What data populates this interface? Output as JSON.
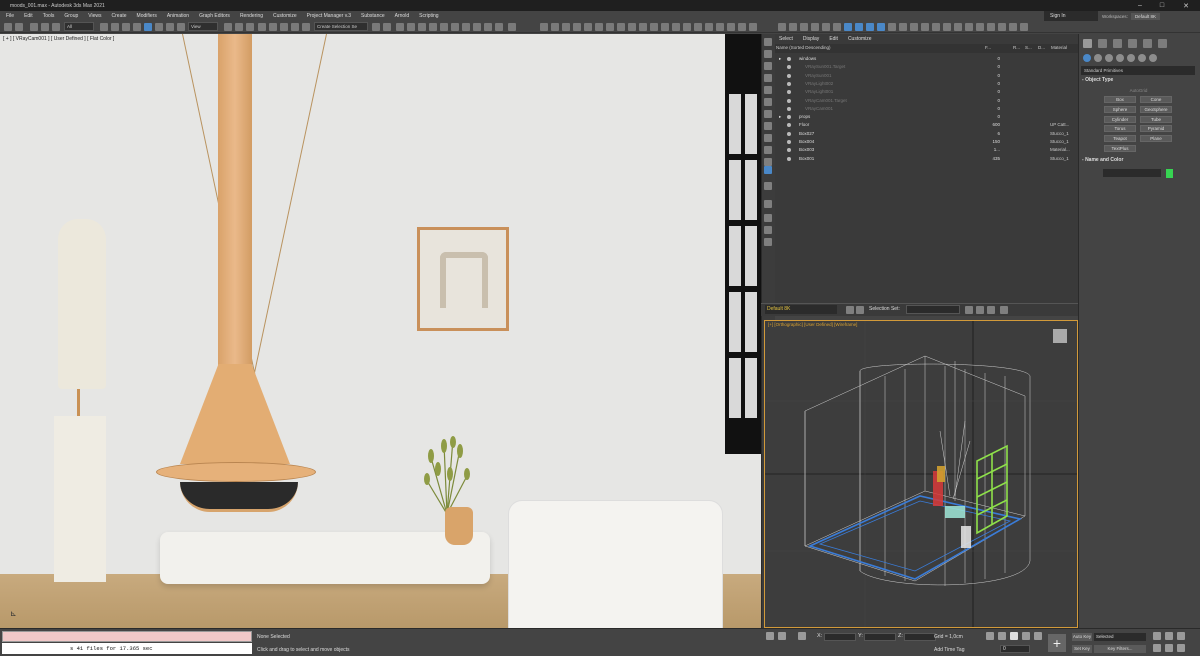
{
  "window": {
    "title": "moods_001.max - Autodesk 3ds Max 2021"
  },
  "menu": [
    "File",
    "Edit",
    "Tools",
    "Group",
    "Views",
    "Create",
    "Modifiers",
    "Animation",
    "Graph Editors",
    "Rendering",
    "Customize",
    "Project Manager v.3",
    "Substance",
    "Arnold",
    "Scripting"
  ],
  "account": {
    "signin": "Sign In",
    "workspace_label": "Workspaces:",
    "workspace_value": "Default 8K"
  },
  "toolbar": {
    "filter": "All",
    "view": "View",
    "selection_set": "Create Selection Se"
  },
  "viewport1": {
    "label": "[ + ] [ VRayCam001 ] [ User Defined ] [ Flat Color ]"
  },
  "scene_explorer": {
    "menu": [
      "Select",
      "Display",
      "Edit",
      "Customize"
    ],
    "columns": {
      "name": "Name (Sorted Descending)",
      "faces": "F...",
      "r": "R...",
      "s": "S...",
      "d": "D...",
      "material": "Material"
    },
    "rows": [
      {
        "name": "windows",
        "count": "0",
        "material": "",
        "level": 0,
        "dim": false
      },
      {
        "name": "VRaySun001.Target",
        "count": "0",
        "material": "",
        "level": 1,
        "dim": true
      },
      {
        "name": "VRaySun001",
        "count": "0",
        "material": "",
        "level": 1,
        "dim": true
      },
      {
        "name": "VRayLight002",
        "count": "0",
        "material": "",
        "level": 1,
        "dim": true
      },
      {
        "name": "VRayLight001",
        "count": "0",
        "material": "",
        "level": 1,
        "dim": true
      },
      {
        "name": "VRayCam001.Target",
        "count": "0",
        "material": "",
        "level": 1,
        "dim": true
      },
      {
        "name": "VRayCam001",
        "count": "0",
        "material": "",
        "level": 1,
        "dim": true
      },
      {
        "name": "props",
        "count": "0",
        "material": "",
        "level": 0,
        "dim": false
      },
      {
        "name": "Floor",
        "count": "600",
        "material": "UP Catt...",
        "level": 0,
        "dim": false
      },
      {
        "name": "Box027",
        "count": "6",
        "material": "Stucco_1",
        "level": 0,
        "dim": false
      },
      {
        "name": "Box004",
        "count": "150",
        "material": "Stucco_1",
        "level": 0,
        "dim": false
      },
      {
        "name": "Box003",
        "count": "1...",
        "material": "Material...",
        "level": 0,
        "dim": false
      },
      {
        "name": "Box001",
        "count": "435",
        "material": "Stucco_1",
        "level": 0,
        "dim": false
      }
    ],
    "layer": "Default 8K",
    "selection_set_label": "Selection Set:"
  },
  "viewport2": {
    "label": "[+] [Orthographic] [User Defined] [Wireframe]"
  },
  "command_panel": {
    "dropdown": "Standard Primitives",
    "rollout_object_type": "Object Type",
    "autogrid": "AutoGrid",
    "buttons": [
      "Box",
      "Cone",
      "Sphere",
      "GeoSphere",
      "Cylinder",
      "Tube",
      "Torus",
      "Pyramid",
      "Teapot",
      "Plane",
      "TextPlus"
    ],
    "rollout_name_color": "Name and Color",
    "object_color": "#37d452"
  },
  "statusbar": {
    "script_output": "s 41 files for 17.365 sec",
    "selection": "None Selected",
    "prompt": "Click and drag to select and move objects",
    "x_label": "X:",
    "y_label": "Y:",
    "z_label": "Z:",
    "grid": "Grid = 1,0cm",
    "add_time_tag": "Add Time Tag",
    "frame": "0",
    "auto_key": "Auto Key",
    "set_key": "Set Key",
    "selected": "Selected",
    "key_filters": "Key Filters..."
  }
}
